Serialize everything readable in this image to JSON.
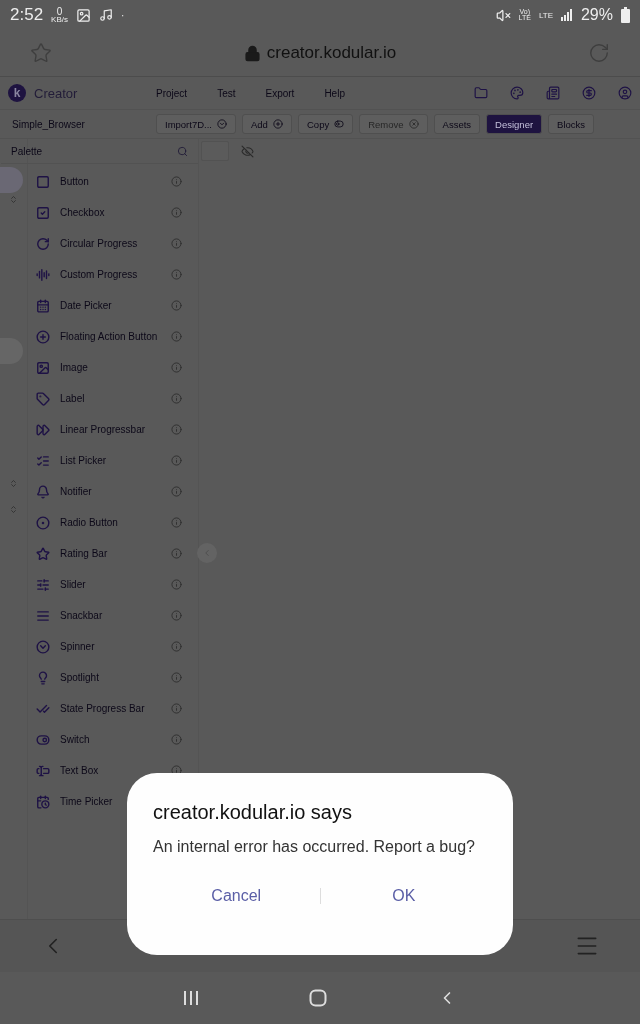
{
  "status_bar": {
    "time": "2:52",
    "speed": "0",
    "speed_unit": "KB/s",
    "dot": "·",
    "volte": "Vo)",
    "volte_sub": "LTE",
    "lte": "LTE",
    "battery": "29%"
  },
  "browser": {
    "url": "creator.kodular.io"
  },
  "app": {
    "brand": "Creator",
    "brand_letter": "k",
    "menu": [
      "Project",
      "Test",
      "Export",
      "Help"
    ]
  },
  "toolbar": {
    "project": "Simple_Browser",
    "actions": [
      {
        "label": "Import7D...",
        "disabled": false
      },
      {
        "label": "Add",
        "disabled": false
      },
      {
        "label": "Copy",
        "disabled": false
      },
      {
        "label": "Remove",
        "disabled": true
      }
    ],
    "views": [
      {
        "label": "Assets",
        "selected": false
      },
      {
        "label": "Designer",
        "selected": true
      },
      {
        "label": "Blocks",
        "selected": false
      }
    ]
  },
  "palette": {
    "title": "Palette",
    "items": [
      "Button",
      "Checkbox",
      "Circular Progress",
      "Custom Progress",
      "Date Picker",
      "Floating Action Button",
      "Image",
      "Label",
      "Linear Progressbar",
      "List Picker",
      "Notifier",
      "Radio Button",
      "Rating Bar",
      "Slider",
      "Snackbar",
      "Spinner",
      "Spotlight",
      "State Progress Bar",
      "Switch",
      "Text Box",
      "Time Picker"
    ]
  },
  "dialog": {
    "title": "creator.kodular.io says",
    "message": "An internal error has occurred. Report a bug?",
    "buttons": [
      "Cancel",
      "OK"
    ]
  }
}
